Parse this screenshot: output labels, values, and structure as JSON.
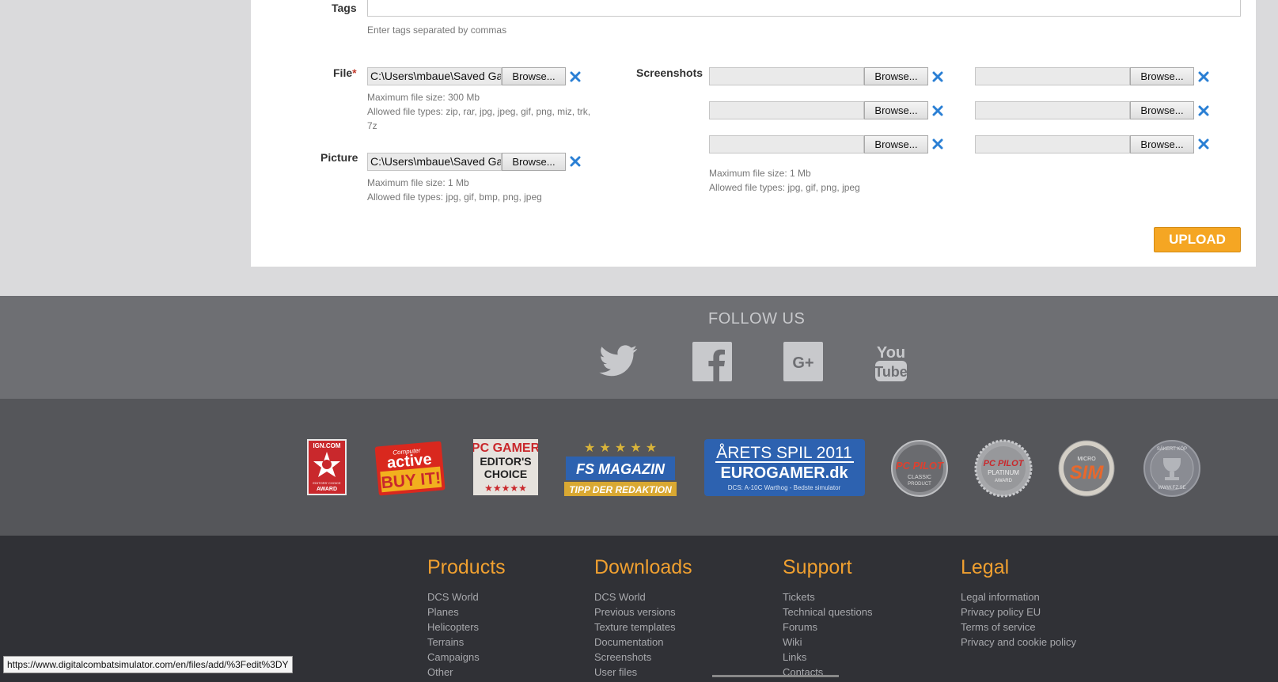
{
  "form": {
    "tags_label": "Tags",
    "tags_value": "",
    "tags_hint": "Enter tags separated by commas",
    "file_label": "File",
    "required_mark": "*",
    "file_value": "C:\\Users\\mbaue\\Saved Gar",
    "file_hint_size": "Maximum file size: 300 Mb",
    "file_hint_types": "Allowed file types: zip, rar, jpg, jpeg, gif, png, miz, trk,",
    "file_hint_types2": "7z",
    "picture_label": "Picture",
    "picture_value": "C:\\Users\\mbaue\\Saved Gar",
    "picture_hint_size": "Maximum file size: 1 Mb",
    "picture_hint_types": "Allowed file types: jpg, gif, bmp, png, jpeg",
    "screenshots_label": "Screenshots",
    "screenshots_hint_size": "Maximum file size: 1 Mb",
    "screenshots_hint_types": "Allowed file types: jpg, gif, png, jpeg",
    "browse_label": "Browse...",
    "upload_label": "UPLOAD"
  },
  "follow": {
    "title": "FOLLOW US",
    "icons": [
      "twitter-icon",
      "facebook-icon",
      "google-plus-icon",
      "youtube-icon"
    ]
  },
  "awards": {
    "ign_l1": "IGN.COM",
    "ign_l2": "EDITORS' CHOICE",
    "ign_l3": "AWARD",
    "active_l1": "Computer",
    "active_l2": "active",
    "active_l3": "BUY IT!",
    "pcgamer_l1": "PC GAMER",
    "pcgamer_l2": "EDITOR'S",
    "pcgamer_l3": "CHOICE",
    "fs_l1": "FS MAGAZIN",
    "fs_l2": "TIPP DER REDAKTION",
    "euro_l1": "ÅRETS SPIL 2011",
    "euro_l2": "EUROGAMER.dk",
    "euro_l3": "DCS: A-10C Warthog - Bedste simulator",
    "pcpilot1_l1": "PC PILOT",
    "pcpilot1_l2": "CLASSIC",
    "pcpilot1_l3": "PRODUCT",
    "pcpilot2_l1": "PC PILOT",
    "pcpilot2_l2": "PLATINUM",
    "pcpilot2_l3": "AWARD",
    "microsim_l1": "MICRO",
    "microsim_l2": "SIM",
    "fz_l1": "SÄKERT KÖP",
    "fz_l2": "WWW.FZ.SE"
  },
  "footer": {
    "products": {
      "title": "Products",
      "links": [
        "DCS World",
        "Planes",
        "Helicopters",
        "Terrains",
        "Campaigns",
        "Other"
      ]
    },
    "downloads": {
      "title": "Downloads",
      "links": [
        "DCS World",
        "Previous versions",
        "Texture templates",
        "Documentation",
        "Screenshots",
        "User files"
      ]
    },
    "support": {
      "title": "Support",
      "links": [
        "Tickets",
        "Technical questions",
        "Forums",
        "Wiki",
        "Links",
        "Contacts"
      ]
    },
    "legal": {
      "title": "Legal",
      "links": [
        "Legal information",
        "Privacy policy EU",
        "Terms of service",
        "Privacy and cookie policy"
      ]
    }
  },
  "status_url": "https://www.digitalcombatsimulator.com/en/files/add/%3Fedit%3DY",
  "colors": {
    "accent": "#f5a623",
    "link_heading": "#f0a030",
    "close_icon": "#2a7fd4"
  }
}
